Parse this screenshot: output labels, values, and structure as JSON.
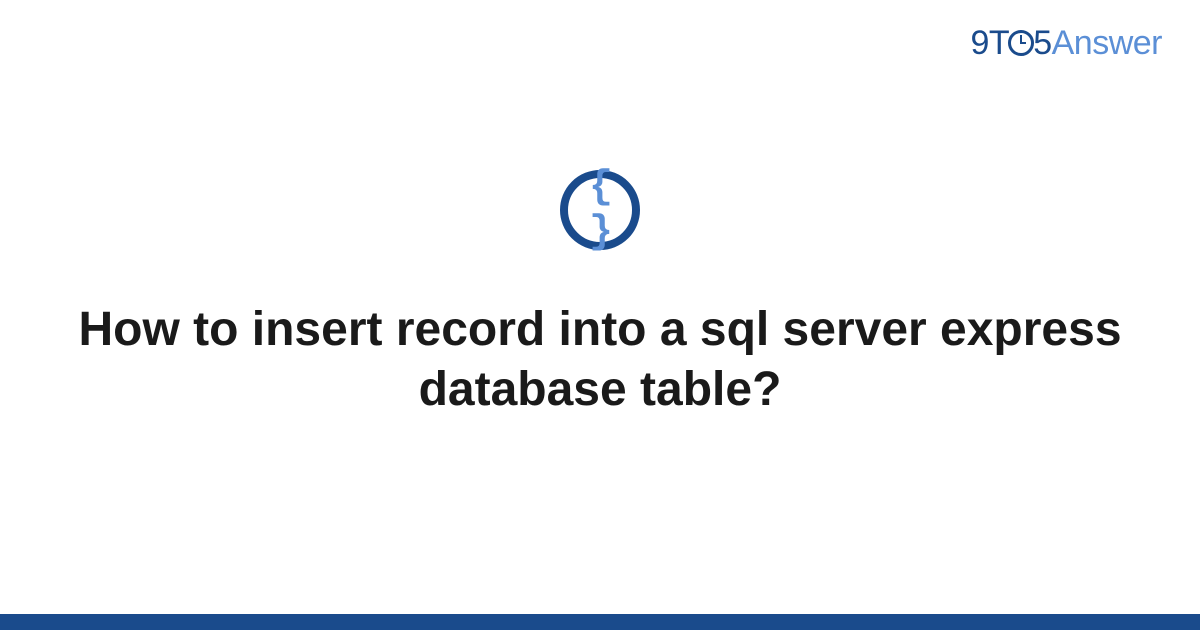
{
  "brand": {
    "part1": "9T",
    "part2": "5",
    "part3": "Answer"
  },
  "icon": {
    "glyph": "{ }",
    "name": "code-braces"
  },
  "title": "How to insert record into a sql server express database table?",
  "colors": {
    "primary": "#1a4b8c",
    "secondary": "#5b8fd6"
  }
}
